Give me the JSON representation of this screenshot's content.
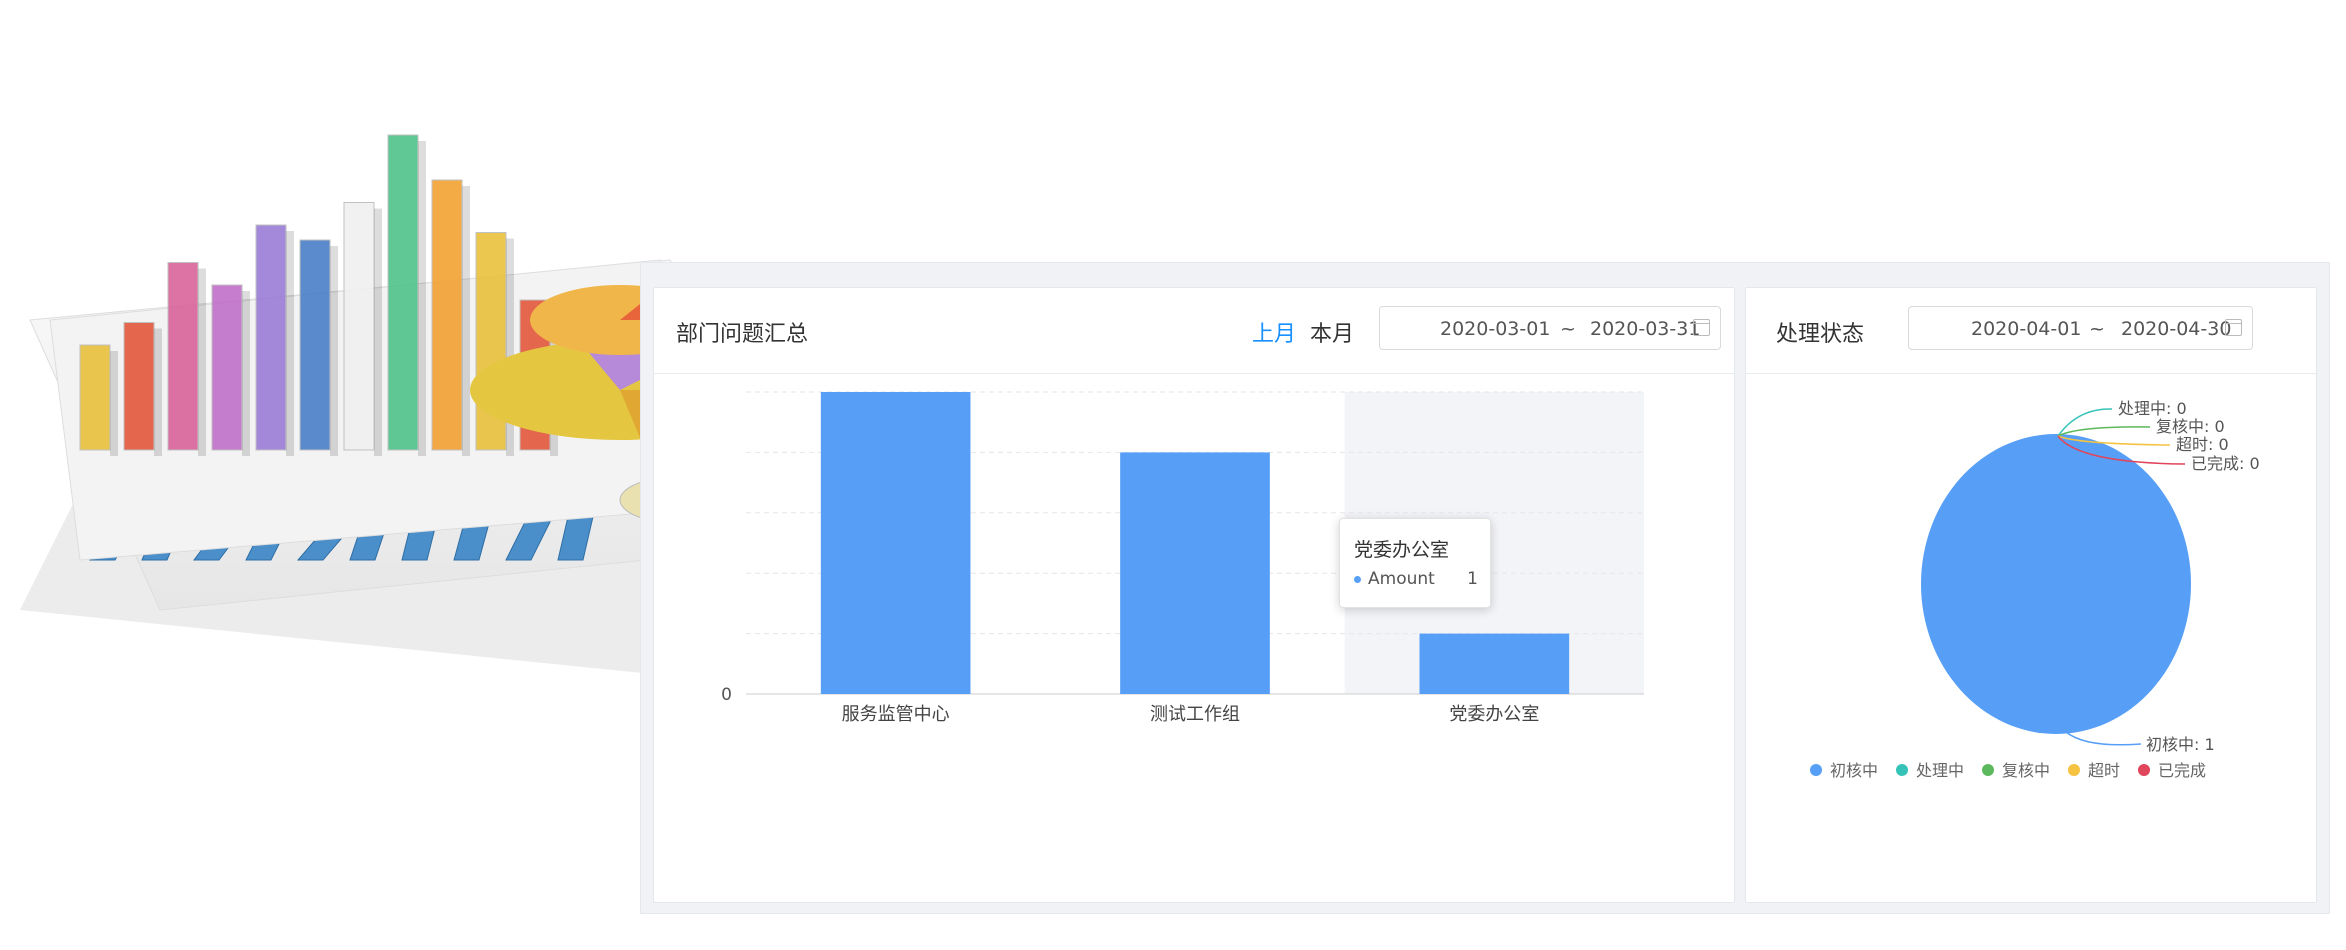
{
  "bar_panel": {
    "title": "部门问题汇总",
    "tabs": [
      {
        "label": "上月",
        "active": true
      },
      {
        "label": "本月",
        "active": false
      }
    ],
    "date_range": {
      "start": "2020-03-01",
      "sep": "~",
      "end": "2020-03-31"
    }
  },
  "pie_panel": {
    "title": "处理状态",
    "date_range": {
      "start": "2020-04-01",
      "sep": "~",
      "end": "2020-04-30"
    }
  },
  "tooltip": {
    "title": "党委办公室",
    "series_name": "Amount",
    "value": "1"
  },
  "colors": {
    "accent": "#1890ff",
    "bar": "#579ff6",
    "pie_main": "#579ff6",
    "status": [
      "#579ff6",
      "#35c3b8",
      "#5cb85c",
      "#f5c242",
      "#e0455b"
    ]
  },
  "chart_data": [
    {
      "type": "bar",
      "categories": [
        "服务监管中心",
        "测试工作组",
        "党委办公室"
      ],
      "series": [
        {
          "name": "Amount",
          "values": [
            5,
            4,
            1
          ]
        }
      ],
      "ylim": [
        0,
        5
      ],
      "y_ticks": [
        "0"
      ],
      "highlighted_category": 2,
      "grid": true
    },
    {
      "type": "pie",
      "labels": [
        "初核中",
        "处理中",
        "复核中",
        "超时",
        "已完成"
      ],
      "values": [
        1,
        0,
        0,
        0,
        0
      ],
      "slice_labels": [
        "初核中: 1",
        "处理中: 0",
        "复核中: 0",
        "超时: 0",
        "已完成: 0"
      ],
      "legend": "bottom"
    }
  ]
}
